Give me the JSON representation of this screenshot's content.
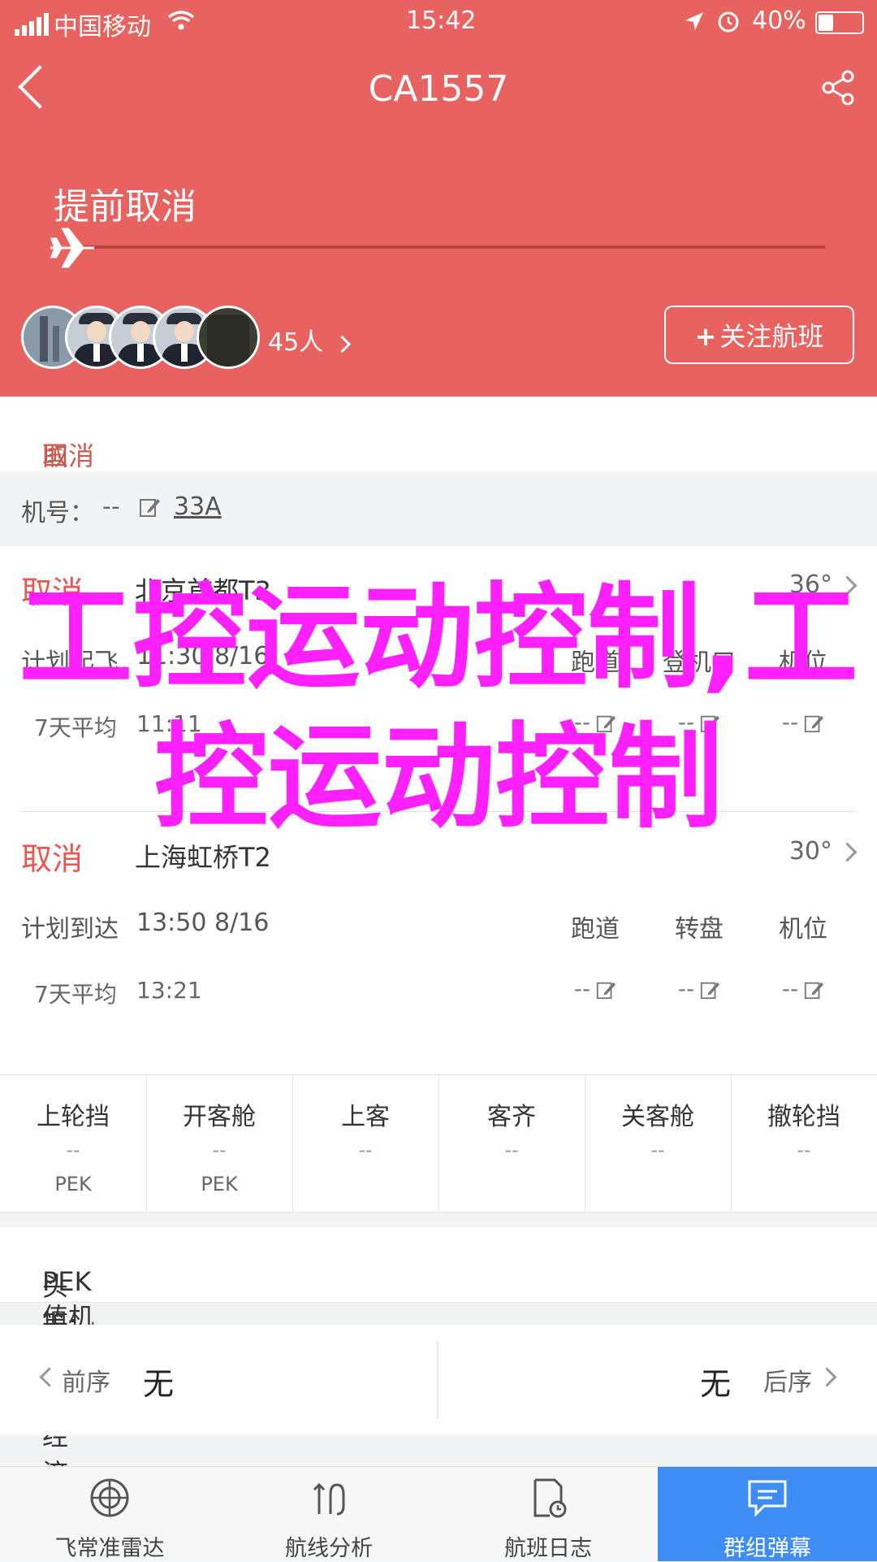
{
  "status_bar": {
    "carrier": "中国移动",
    "time": "15:42",
    "battery": "40%"
  },
  "nav": {
    "title": "CA1557"
  },
  "flight_status": {
    "title": "提前取消"
  },
  "followers": {
    "count_label": "45人"
  },
  "follow_button": {
    "label": "关注航班",
    "plus": "+"
  },
  "cancel_reason": {
    "label": "取消原因：",
    "value": "国航原因"
  },
  "aircraft": {
    "label": "机号：",
    "value": "--",
    "link": "33A"
  },
  "departure": {
    "state": "取消",
    "airport": "北京首都T3",
    "temp": "36°",
    "plan_label": "计划起飞",
    "plan_value": "11:30 8/16",
    "avg_label": "7天平均",
    "avg_value": "11:11",
    "columns": [
      "跑道",
      "登机口",
      "机位"
    ],
    "values": [
      "--",
      "--",
      "--"
    ]
  },
  "arrival": {
    "state": "取消",
    "airport": "上海虹桥T2",
    "temp": "30°",
    "plan_label": "计划到达",
    "plan_value": "13:50 8/16",
    "avg_label": "7天平均",
    "avg_value": "13:21",
    "columns": [
      "跑道",
      "转盘",
      "机位"
    ],
    "values": [
      "--",
      "--",
      "--"
    ]
  },
  "boarding": [
    {
      "title": "上轮挡",
      "value": "--",
      "sub": "PEK"
    },
    {
      "title": "开客舱",
      "value": "--",
      "sub": "PEK"
    },
    {
      "title": "上客",
      "value": "--",
      "sub": ""
    },
    {
      "title": "客齐",
      "value": "--",
      "sub": ""
    },
    {
      "title": "关客舱",
      "value": "--",
      "sub": ""
    },
    {
      "title": "撤轮挡",
      "value": "--",
      "sub": ""
    }
  ],
  "checkin": {
    "label": "PEK值机柜台：",
    "value": "头等;商务;经济"
  },
  "sequence": {
    "prev_label": "前序",
    "prev_value": "无",
    "next_value": "无",
    "next_label": "后序"
  },
  "tabs": [
    {
      "label": "飞常准雷达",
      "icon": "radar-icon"
    },
    {
      "label": "航线分析",
      "icon": "route-icon"
    },
    {
      "label": "航班日志",
      "icon": "log-icon"
    },
    {
      "label": "群组弹幕",
      "icon": "chat-icon"
    }
  ],
  "overlay_text": "工控运动控制,工控运动控制",
  "colors": {
    "header": "#e8625f",
    "accent_red": "#e65850",
    "tab_active": "#3d8df5",
    "overlay": "#ff20ff"
  }
}
